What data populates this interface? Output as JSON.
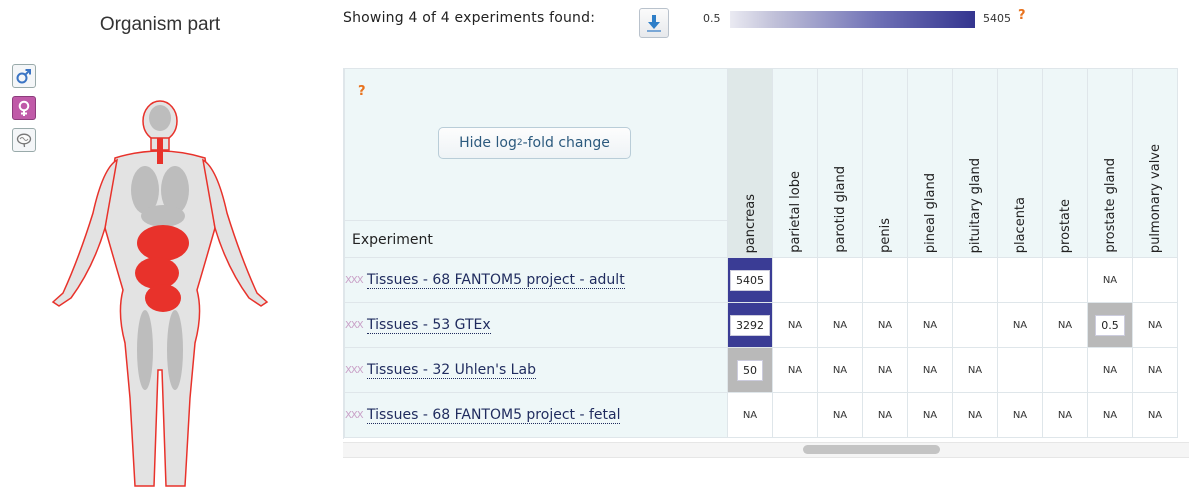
{
  "anatomogram": {
    "title": "Organism part",
    "buttons": [
      {
        "name": "male",
        "icon": "male-symbol-icon"
      },
      {
        "name": "female",
        "icon": "female-symbol-icon"
      },
      {
        "name": "brain",
        "icon": "brain-icon"
      }
    ]
  },
  "toolbar": {
    "showing_text": "Showing 4 of 4 experiments found:",
    "download_icon": "download-arrow-icon"
  },
  "legend": {
    "min": "0.5",
    "max": "5405",
    "help": "?"
  },
  "table": {
    "help": "?",
    "hide_button_prefix": "Hide log",
    "hide_button_sub": "2",
    "hide_button_suffix": "-fold change",
    "experiment_header": "Experiment",
    "columns": [
      "pancreas",
      "parietal lobe",
      "parotid gland",
      "penis",
      "pineal gland",
      "pituitary gland",
      "placenta",
      "prostate",
      "prostate gland",
      "pulmonary valve"
    ],
    "rows": [
      {
        "icon": "XXX",
        "label": "Tissues - 68 FANTOM5 project - adult",
        "cells": [
          "5405",
          "",
          "",
          "",
          "",
          "",
          "",
          "",
          "NA",
          ""
        ]
      },
      {
        "icon": "XXX",
        "label": "Tissues - 53 GTEx",
        "cells": [
          "3292",
          "NA",
          "NA",
          "NA",
          "NA",
          "",
          "NA",
          "NA",
          "0.5",
          "NA"
        ]
      },
      {
        "icon": "XXX",
        "label": "Tissues - 32 Uhlen's Lab",
        "cells": [
          "50",
          "NA",
          "NA",
          "NA",
          "NA",
          "NA",
          "",
          "",
          "NA",
          "NA"
        ]
      },
      {
        "icon": "XXX",
        "label": "Tissues - 68 FANTOM5 project - fetal",
        "cells": [
          "NA",
          "",
          "NA",
          "NA",
          "NA",
          "NA",
          "NA",
          "NA",
          "NA",
          "NA"
        ]
      }
    ]
  },
  "colors": {
    "high": "#3a3c95",
    "low": "#b9b9b9",
    "accent": "#e8721d",
    "highlight": "#e8322b"
  }
}
